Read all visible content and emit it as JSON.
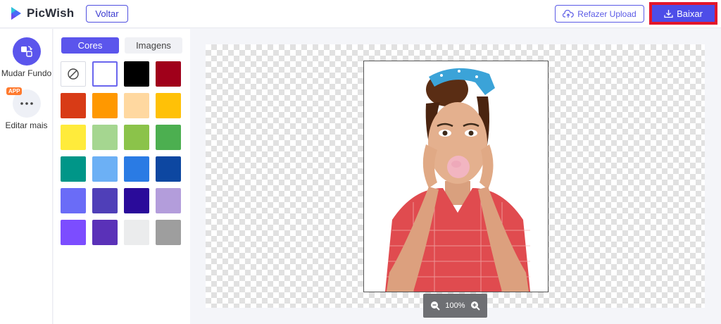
{
  "app": {
    "name": "PicWish"
  },
  "header": {
    "back_label": "Voltar",
    "reupload_label": "Refazer Upload",
    "download_label": "Baixar"
  },
  "sidebar": {
    "items": [
      {
        "label": "Mudar Fundo",
        "icon": "change-background-icon",
        "active": true
      },
      {
        "label": "Editar mais",
        "icon": "more-dots-icon",
        "badge": "APP",
        "active": false
      }
    ]
  },
  "color_panel": {
    "tabs": [
      {
        "label": "Cores",
        "active": true
      },
      {
        "label": "Imagens",
        "active": false
      }
    ],
    "swatches": [
      "none",
      "#ffffff",
      "#000000",
      "#a0001a",
      "#d83b16",
      "#ff9800",
      "#ffd8a0",
      "#ffc107",
      "#ffeb3b",
      "#a5d690",
      "#8bc34a",
      "#4caf50",
      "#009688",
      "#6cb0f5",
      "#2a7be4",
      "#0d47a1",
      "#6a6cf7",
      "#4f3fb8",
      "#2a0b9a",
      "#b39ddb",
      "#7c4dff",
      "#5a31b8",
      "#ebeced",
      "#9e9e9e"
    ],
    "selected": "#ffffff"
  },
  "canvas": {
    "zoom": "100%"
  },
  "colors": {
    "accent": "#5b55ec",
    "download_outline": "#e3162b"
  }
}
